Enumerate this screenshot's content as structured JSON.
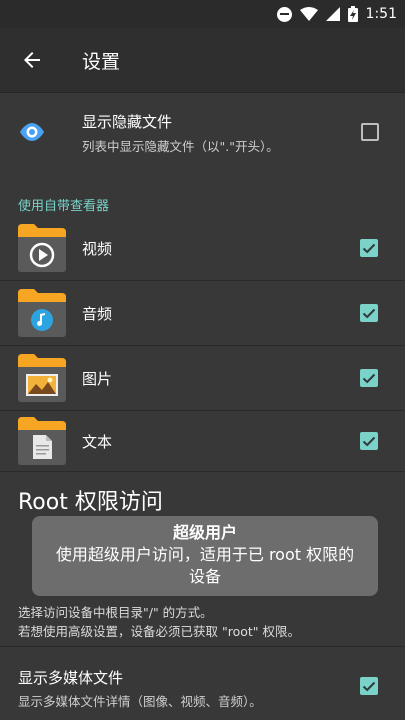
{
  "status_bar": {
    "time": "1:51"
  },
  "app_bar": {
    "title": "设置"
  },
  "hidden_files": {
    "title": "显示隐藏文件",
    "subtitle": "列表中显示隐藏文件（以\".\"开头）。",
    "checked": false
  },
  "viewer_section": {
    "header": "使用自带查看器",
    "items": [
      {
        "label": "视频",
        "icon": "folder-video-icon",
        "checked": true
      },
      {
        "label": "音频",
        "icon": "folder-music-icon",
        "checked": true
      },
      {
        "label": "图片",
        "icon": "folder-image-icon",
        "checked": true
      },
      {
        "label": "文本",
        "icon": "folder-document-icon",
        "checked": true
      }
    ]
  },
  "root_section": {
    "title": "Root 权限访问",
    "desc_line1": "选择访问设备中根目录\"/\" 的方式。",
    "desc_line2": "若想使用高级设置，设备必须已获取 \"root\" 权限。"
  },
  "toast": {
    "title": "超级用户",
    "message": "使用超级用户访问，适用于已 root 权限的设备"
  },
  "media_files": {
    "title": "显示多媒体文件",
    "subtitle": "显示多媒体文件详情（图像、视频、音频）。",
    "checked": true
  },
  "colors": {
    "accent": "#7ad2c8",
    "background": "#383838",
    "toast": "#6d6d6d"
  }
}
